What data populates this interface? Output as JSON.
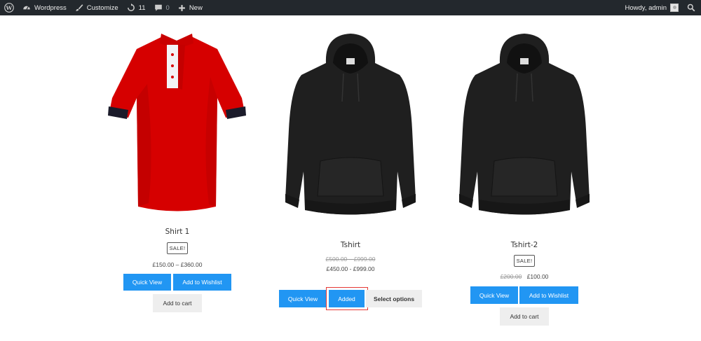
{
  "admin_bar": {
    "site_name": "Wordpress",
    "customize_label": "Customize",
    "updates_count": "11",
    "comments_count": "0",
    "new_label": "New",
    "greeting": "Howdy, admin"
  },
  "products": [
    {
      "title": "Shirt 1",
      "sale_badge": "SALE!",
      "price_range": "£150.00 – £360.00",
      "quick_view_label": "Quick View",
      "wishlist_label": "Add to Wishlist",
      "cart_label": "Add to cart",
      "image": "red-polo-shirt",
      "image_color": "#d40000"
    },
    {
      "title": "Tshirt",
      "old_price_range": "£500.00 – £999.00",
      "price_range": "£450.00 - £999.00",
      "quick_view_label": "Quick View",
      "added_label": "Added",
      "select_options_label": "Select options",
      "image": "black-hoodie",
      "image_color": "#1e1e1e"
    },
    {
      "title": "Tshirt-2",
      "sale_badge": "SALE!",
      "old_price": "£200.00",
      "price": "£100.00",
      "quick_view_label": "Quick View",
      "wishlist_label": "Add to Wishlist",
      "cart_label": "Add to cart",
      "image": "black-hoodie",
      "image_color": "#1e1e1e"
    }
  ],
  "colors": {
    "admin_bar_bg": "#23282d",
    "button_blue": "#2196f3",
    "button_grey": "#eeeeee",
    "highlight_red": "#e53935"
  }
}
